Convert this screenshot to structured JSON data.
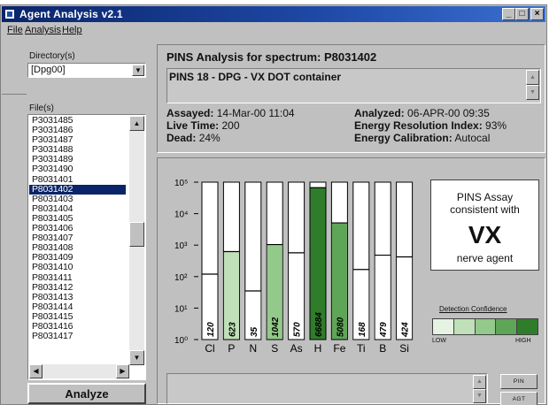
{
  "window": {
    "title": "Agent Analysis v2.1",
    "controls": {
      "minimize": "_",
      "maximize": "□",
      "close": "×"
    }
  },
  "menu": [
    "File",
    "Analysis",
    "Help"
  ],
  "left_panel": {
    "directory_label": "Directory(s)",
    "directory_value": "[Dpg00]",
    "files_label": "File(s)",
    "files": [
      "P3031485",
      "P3031486",
      "P3031487",
      "P3031488",
      "P3031489",
      "P3031490",
      "P8031401",
      "P8031402",
      "P8031403",
      "P8031404",
      "P8031405",
      "P8031406",
      "P8031407",
      "P8031408",
      "P8031409",
      "P8031410",
      "P8031411",
      "P8031412",
      "P8031413",
      "P8031414",
      "P8031415",
      "P8031416",
      "P8031417"
    ],
    "selected_file": "P8031402",
    "vertical_scroll_position": 0.47,
    "analyze_label": "Analyze"
  },
  "spectrum": {
    "title": "PINS Analysis for spectrum:  P8031402",
    "description": "PINS 18 - DPG - VX DOT container",
    "assayed_label": "Assayed:",
    "assayed_value": "14-Mar-00 11:04",
    "live_time_label": "Live Time:",
    "live_time_value": "200",
    "dead_label": "Dead:",
    "dead_value": "24%",
    "analyzed_label": "Analyzed:",
    "analyzed_value": "06-APR-00 09:35",
    "eri_label": "Energy Resolution Index:",
    "eri_value": "93%",
    "calib_label": "Energy Calibration:",
    "calib_value": "Autocal"
  },
  "chart_data": {
    "type": "bar",
    "scale": "log",
    "categories": [
      "Cl",
      "P",
      "N",
      "S",
      "As",
      "H",
      "Fe",
      "Ti",
      "B",
      "Si"
    ],
    "values": [
      120,
      623,
      35,
      1042,
      570,
      66884,
      5080,
      168,
      479,
      424
    ],
    "labels": [
      "120",
      "623",
      "35",
      "1042",
      "570",
      "66884",
      "5080",
      "168",
      "479",
      "424"
    ],
    "ylim_exponent": [
      0,
      5
    ],
    "ytick_labels": [
      "10⁰",
      "10¹",
      "10²",
      "10³",
      "10⁴",
      "10⁵"
    ],
    "confidence_level": [
      0,
      1,
      0,
      2,
      0,
      4,
      3,
      0,
      0,
      0
    ]
  },
  "assay": {
    "line1": "PINS Assay",
    "line2": "consistent with",
    "agent": "VX",
    "line3": "nerve agent"
  },
  "confidence": {
    "title": "Detection Confidence",
    "low": "LOW",
    "high": "HIGH",
    "colors": [
      "#e6f2e2",
      "#bfe0b8",
      "#93c98a",
      "#5fa557",
      "#2f7d2a"
    ]
  },
  "buttons": {
    "pin": "PIN",
    "agt": "AGT"
  }
}
